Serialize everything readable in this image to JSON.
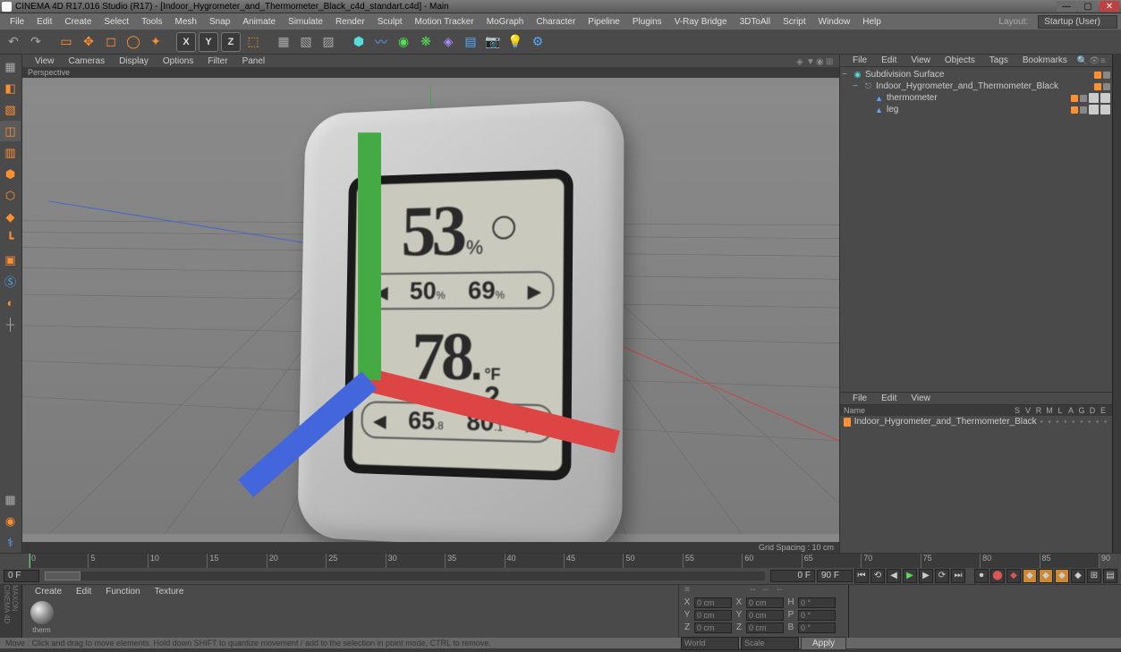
{
  "title": "CINEMA 4D R17.016 Studio (R17) - [Indoor_Hygrometer_and_Thermometer_Black_c4d_standart.c4d] - Main",
  "menubar": [
    "File",
    "Edit",
    "Create",
    "Select",
    "Tools",
    "Mesh",
    "Snap",
    "Animate",
    "Simulate",
    "Render",
    "Sculpt",
    "Motion Tracker",
    "MoGraph",
    "Character",
    "Pipeline",
    "Plugins",
    "V-Ray Bridge",
    "3DToAll",
    "Script",
    "Window",
    "Help"
  ],
  "layout_label": "Layout:",
  "layout_value": "Startup (User)",
  "vp_menu": [
    "View",
    "Cameras",
    "Display",
    "Options",
    "Filter",
    "Panel"
  ],
  "vp_label": "Perspective",
  "grid_spacing": "Grid Spacing : 10 cm",
  "obj_panel_menu": [
    "File",
    "Edit",
    "View",
    "Objects",
    "Tags",
    "Bookmarks"
  ],
  "tree": [
    {
      "indent": 0,
      "toggle": "−",
      "icon": "sds",
      "name": "Subdivision Surface",
      "dots": true,
      "tags": 0
    },
    {
      "indent": 1,
      "toggle": "−",
      "icon": "null",
      "name": "Indoor_Hygrometer_and_Thermometer_Black",
      "dots": true,
      "tags": 0
    },
    {
      "indent": 2,
      "toggle": "",
      "icon": "poly",
      "name": "thermometer",
      "dots": true,
      "tags": 2
    },
    {
      "indent": 2,
      "toggle": "",
      "icon": "poly",
      "name": "leg",
      "dots": true,
      "tags": 2
    }
  ],
  "attr_panel_menu": [
    "File",
    "Edit",
    "View"
  ],
  "attr_header": {
    "name": "Name",
    "cols": [
      "S",
      "V",
      "R",
      "M",
      "L",
      "A",
      "G",
      "D",
      "E"
    ]
  },
  "attr_row": {
    "name": "Indoor_Hygrometer_and_Thermometer_Black"
  },
  "timeline": {
    "start_frame": "0 F",
    "end_frame": "90 F",
    "cur_frame": "0 F",
    "range_end": "90 F",
    "ticks": [
      0,
      5,
      10,
      15,
      20,
      25,
      30,
      35,
      40,
      45,
      50,
      55,
      60,
      65,
      70,
      75,
      80,
      85,
      90
    ]
  },
  "mat_menu": [
    "Create",
    "Edit",
    "Function",
    "Texture"
  ],
  "materials": [
    {
      "label": "therm"
    }
  ],
  "coord": {
    "rows": [
      {
        "a": "X",
        "av": "0 cm",
        "b": "X",
        "bv": "0 cm",
        "c": "H",
        "cv": "0 °"
      },
      {
        "a": "Y",
        "av": "0 cm",
        "b": "Y",
        "bv": "0 cm",
        "c": "P",
        "cv": "0 °"
      },
      {
        "a": "Z",
        "av": "0 cm",
        "b": "Z",
        "bv": "0 cm",
        "c": "B",
        "cv": "0 °"
      }
    ],
    "sel1": "World",
    "sel2": "Scale",
    "apply": "Apply"
  },
  "status": "Move : Click and drag to move elements. Hold down SHIFT to quantize movement / add to the selection in point mode, CTRL to remove.",
  "device": {
    "humidity": "53",
    "humidity_unit": "%",
    "humid_lo": "50",
    "humid_lo_u": "%",
    "humid_hi": "69",
    "humid_hi_u": "%",
    "temp_int": "78",
    "temp_dec": "2",
    "temp_unit_f": "°F",
    "temp_lo": "65",
    "temp_lo_d": "8",
    "temp_hi": "80",
    "temp_hi_d": "1"
  },
  "brand": "MAXON CINEMA 4D"
}
